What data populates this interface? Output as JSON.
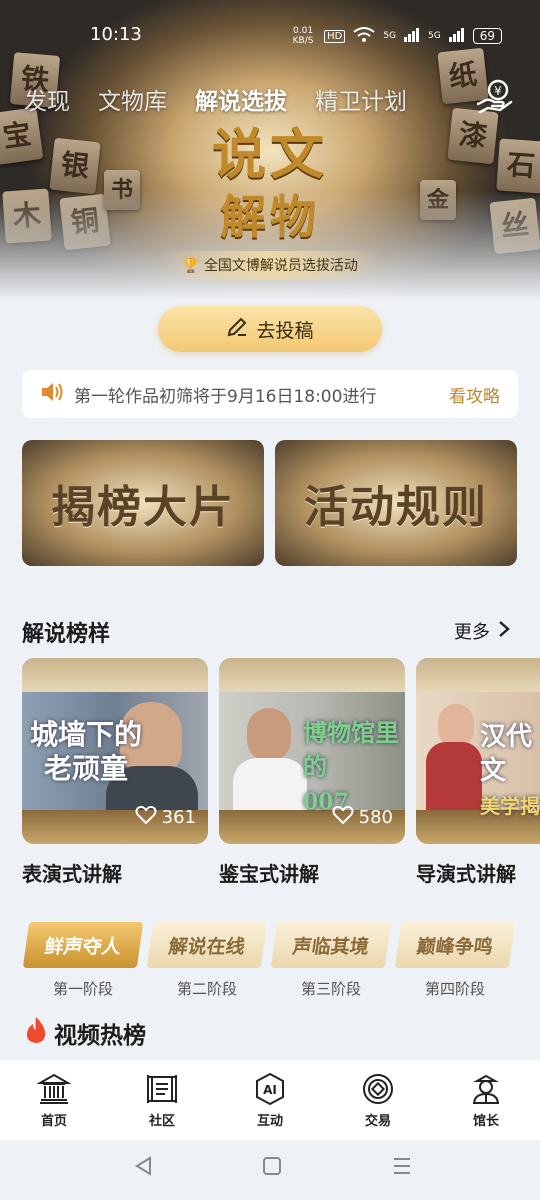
{
  "status": {
    "time": "10:13",
    "speed": "0.01 KB/S",
    "hd": "HD",
    "net1": "5G",
    "net2": "5G",
    "battery": "69"
  },
  "tabs": [
    {
      "label": "发现",
      "active": false
    },
    {
      "label": "文物库",
      "active": false
    },
    {
      "label": "解说选拔",
      "active": true
    },
    {
      "label": "精卫计划",
      "active": false
    }
  ],
  "hero": {
    "title_line1": "说文",
    "title_line2": "解物",
    "subtitle": "全国文博解说员选拔活动"
  },
  "submit_label": "去投稿",
  "notice": {
    "text": "第一轮作品初筛将于9月16日18:00进行",
    "link": "看攻略"
  },
  "banners": [
    "揭榜大片",
    "活动规则"
  ],
  "section": {
    "title": "解说榜样",
    "more": "更多"
  },
  "cards": [
    {
      "overlay_line1": "城墙下的",
      "overlay_line2": "老顽童",
      "likes": "361",
      "label": "表演式讲解"
    },
    {
      "overlay_line1": "博物馆里的",
      "overlay_line2": "007",
      "likes": "580",
      "label": "鉴宝式讲解"
    },
    {
      "overlay_line1": "汉代文",
      "overlay_line2": "美学揭",
      "likes": "",
      "label": "导演式讲解"
    }
  ],
  "stages": [
    {
      "name": "鲜声夺人",
      "caption": "第一阶段",
      "active": true
    },
    {
      "name": "解说在线",
      "caption": "第二阶段",
      "active": false
    },
    {
      "name": "声临其境",
      "caption": "第三阶段",
      "active": false
    },
    {
      "name": "巅峰争鸣",
      "caption": "第四阶段",
      "active": false
    }
  ],
  "hot_title": "视频热榜",
  "nav": [
    {
      "label": "首页",
      "icon": "museum-icon"
    },
    {
      "label": "社区",
      "icon": "scroll-icon"
    },
    {
      "label": "互动",
      "icon": "ai-icon"
    },
    {
      "label": "交易",
      "icon": "coin-icon"
    },
    {
      "label": "馆长",
      "icon": "curator-icon"
    }
  ],
  "colors": {
    "accent": "#b98830",
    "button": "#f3c874",
    "background": "#eef1f5"
  }
}
